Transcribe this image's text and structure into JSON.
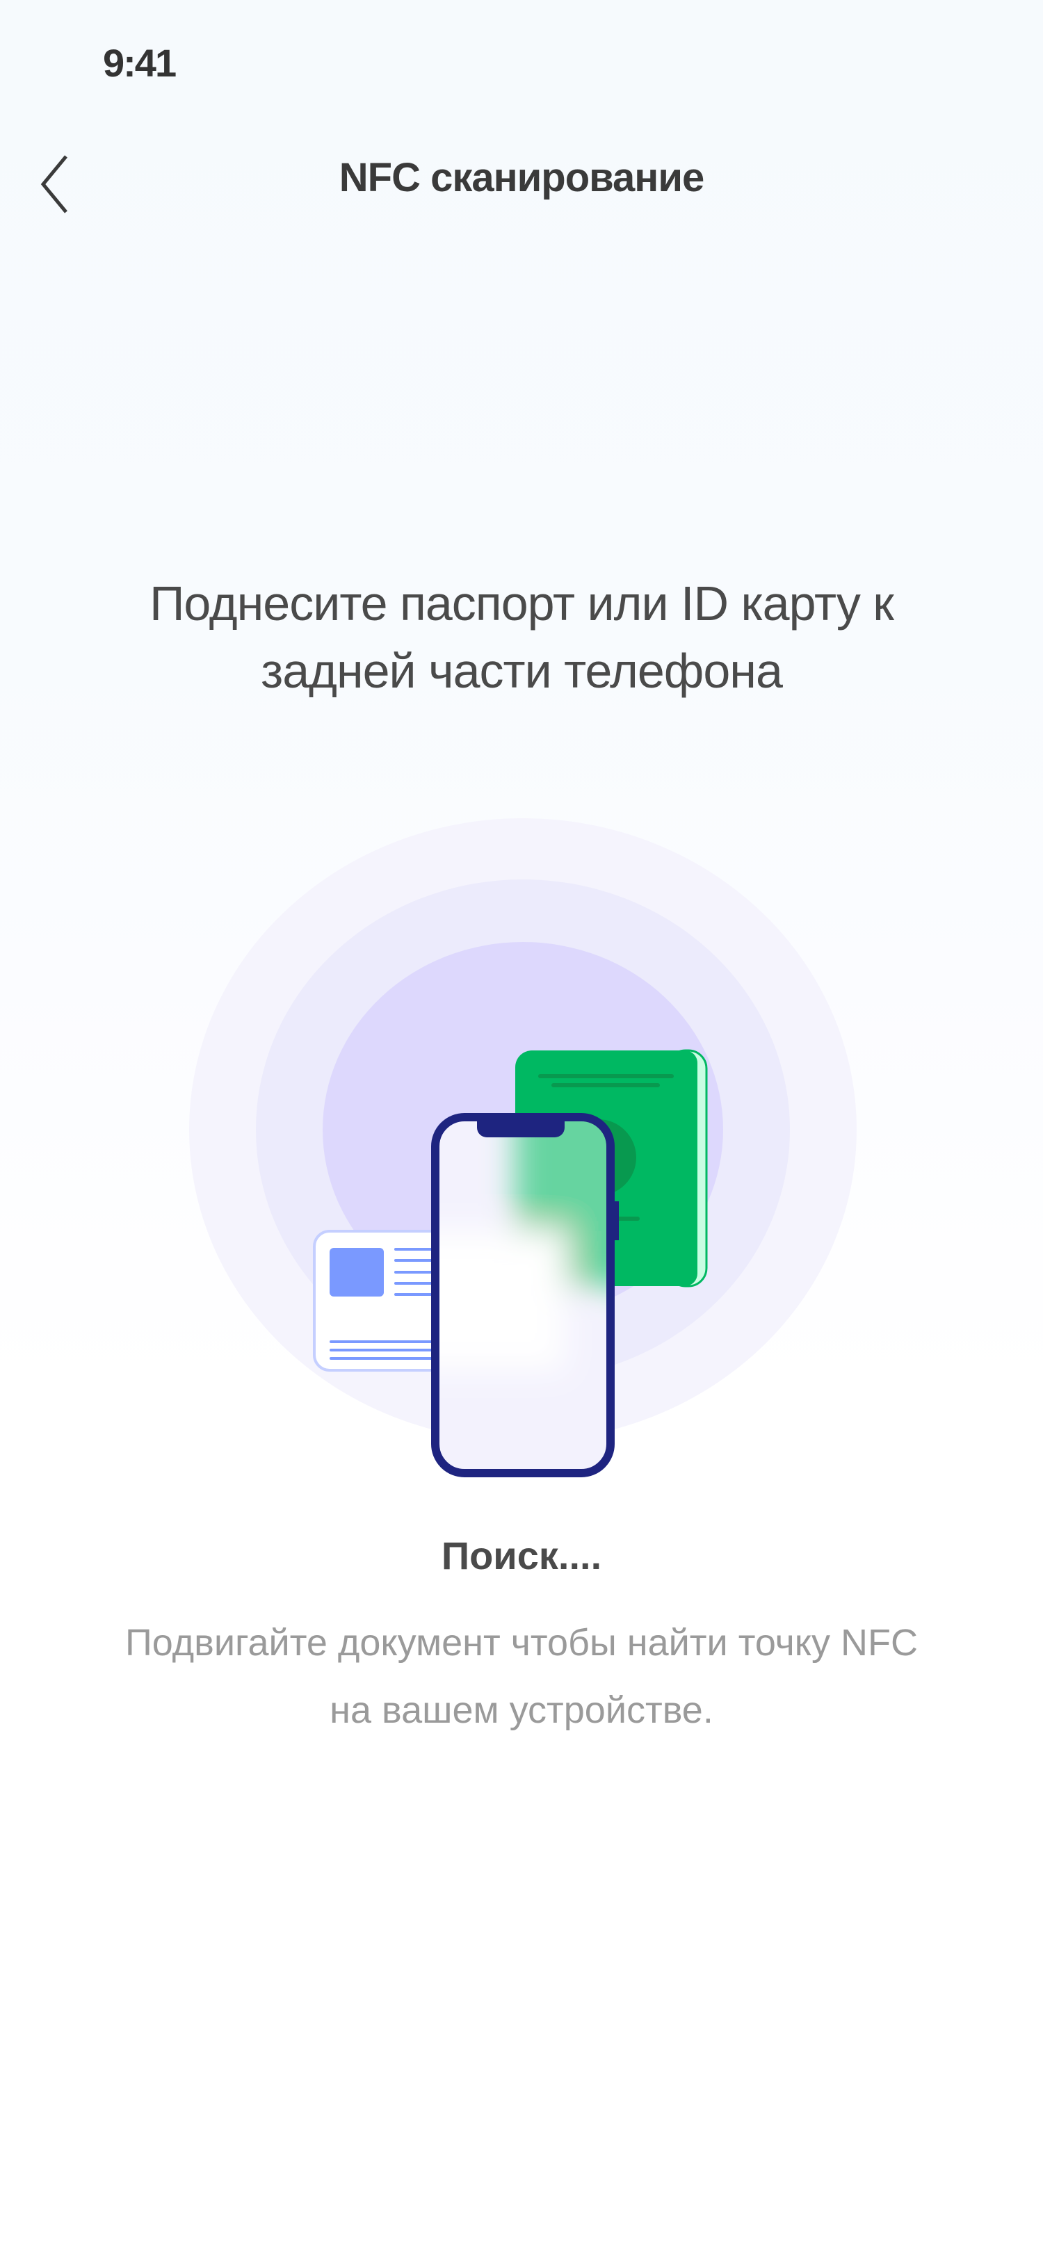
{
  "status_bar": {
    "time": "9:41"
  },
  "header": {
    "title": "NFC сканирование",
    "back_icon": "chevron-left-icon"
  },
  "main": {
    "heading": "Поднесите паспорт или ID карту к задней части телефона",
    "status": "Поиск....",
    "description": "Подвигайте документ чтобы найти точку NFC на вашем устройстве."
  },
  "colors": {
    "phone_frame": "#1e2480",
    "passport": "#00b862",
    "passport_dark": "#08994f",
    "id_card_accent": "#7a99ff",
    "ring_inner": "#ddd8fd",
    "ring_middle": "#ecebfc",
    "ring_outer": "#f5f4fd"
  }
}
